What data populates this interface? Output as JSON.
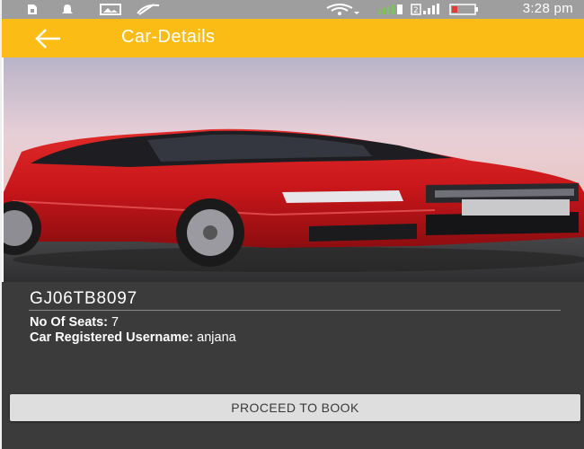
{
  "status_bar": {
    "time": "3:28 pm",
    "icons": [
      "sim-card-icon",
      "notification-bell-icon",
      "image-icon",
      "signal-off-icon",
      "wifi-icon",
      "mobile-data-icon",
      "signal-strength-icon",
      "battery-icon"
    ]
  },
  "app_bar": {
    "title": "Car-Details",
    "back_icon": "back-arrow-icon",
    "background_color": "#fbbd15"
  },
  "car": {
    "registration": "GJ06TB8097",
    "seats_label": "No Of Seats:",
    "seats_value": "7",
    "username_label": "Car Registered Username:",
    "username_value": "anjana"
  },
  "actions": {
    "proceed_label": "PROCEED TO BOOK"
  }
}
